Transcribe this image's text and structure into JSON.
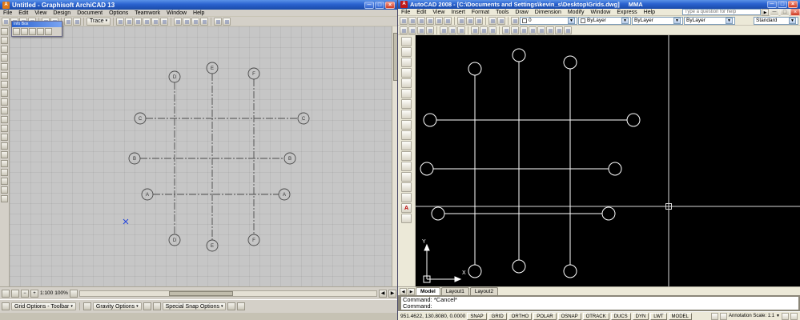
{
  "icons": {
    "minimize": "─",
    "maximize": "□",
    "close": "×",
    "dropdown": "▾",
    "left": "◀",
    "right": "▶",
    "up": "▲",
    "down": "▼"
  },
  "archicad": {
    "title": "Untitled - Graphisoft ArchiCAD 13",
    "menus": [
      "File",
      "Edit",
      "View",
      "Design",
      "Document",
      "Options",
      "Teamwork",
      "Window",
      "Help"
    ],
    "toolbar": {
      "trace_label": "Trace"
    },
    "infobox_title": "Info Box",
    "zoombar": {
      "scale": "1:100",
      "zoom": "100%"
    },
    "optionsbar": {
      "grid_options": "Grid Options - Toolbar",
      "gravity_options": "Gravity Options",
      "special_snap_options": "Special Snap Options"
    },
    "grid": {
      "row_labels": [
        "C",
        "B",
        "A"
      ],
      "col_labels": [
        "D",
        "E",
        "F"
      ]
    }
  },
  "autocad": {
    "title": "AutoCAD 2008 - [C:\\Documents and Settings\\kevin_s\\Desktop\\Grids.dwg]",
    "title_extra": "MMA",
    "menus": [
      "File",
      "Edit",
      "View",
      "Insert",
      "Format",
      "Tools",
      "Draw",
      "Dimension",
      "Modify",
      "Window",
      "Express",
      "Help"
    ],
    "search_placeholder": "Type a question for help",
    "toolbars": {
      "layer": "0",
      "color": "ByLayer",
      "linetype": "ByLayer",
      "lineweight": "ByLayer",
      "style": "Standard"
    },
    "ucs": {
      "x": "X",
      "y": "Y"
    },
    "tabs": [
      "Model",
      "Layout1",
      "Layout2"
    ],
    "command": {
      "line1": "Command: *Cancel*",
      "line2": "Command:"
    },
    "statusbar": {
      "coords": "951.4622, 130.8080, 0.0000",
      "toggles": [
        "SNAP",
        "GRID",
        "ORTHO",
        "POLAR",
        "OSNAP",
        "OTRACK",
        "DUCS",
        "DYN",
        "LWT",
        "MODEL"
      ],
      "annotation_scale": "Annotation Scale: 1:1"
    }
  }
}
